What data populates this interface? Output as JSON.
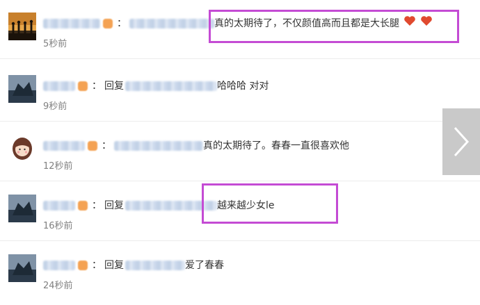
{
  "comments": [
    {
      "colon": "：",
      "reply": "",
      "text": "真的太期待了，不仅颜值高而且都是大长腿",
      "time": "5秒前"
    },
    {
      "colon": "：",
      "reply": "回复",
      "text": "哈哈哈 对对",
      "time": "9秒前"
    },
    {
      "colon": "：",
      "reply": "",
      "text": "真的太期待了。春春一直很喜欢他",
      "time": "12秒前"
    },
    {
      "colon": "：",
      "reply": "回复",
      "text": "越来越少女le",
      "time": "16秒前"
    },
    {
      "colon": "：",
      "reply": "回复",
      "text": "爱了春春",
      "time": "24秒前"
    }
  ],
  "colors": {
    "highlight": "#c44bd4",
    "time": "#808080",
    "nav_arrow_bg": "#c9c9c9"
  },
  "icons": {
    "nav_arrow": "chevron-right-icon",
    "heart": "heart-icon"
  }
}
